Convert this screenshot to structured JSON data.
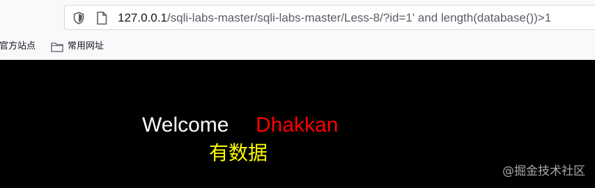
{
  "browser": {
    "url_host": "127.0.0.1",
    "url_path": "/sqli-labs-master/sqli-labs-master/Less-8/?id=1' and length(database())>1",
    "icons": {
      "tracking": "shield-icon",
      "page": "page-icon"
    }
  },
  "bookmarks": {
    "items": [
      {
        "label": "官方站点"
      },
      {
        "label": "常用网址",
        "icon": "folder-icon"
      }
    ]
  },
  "page": {
    "welcome_label": "Welcome",
    "username": "Dhakkan",
    "message": "有数据",
    "watermark": "@掘金技术社区",
    "colors": {
      "background": "#000000",
      "welcome": "#ffffff",
      "username": "#ff0000",
      "message": "#ffff00"
    }
  }
}
